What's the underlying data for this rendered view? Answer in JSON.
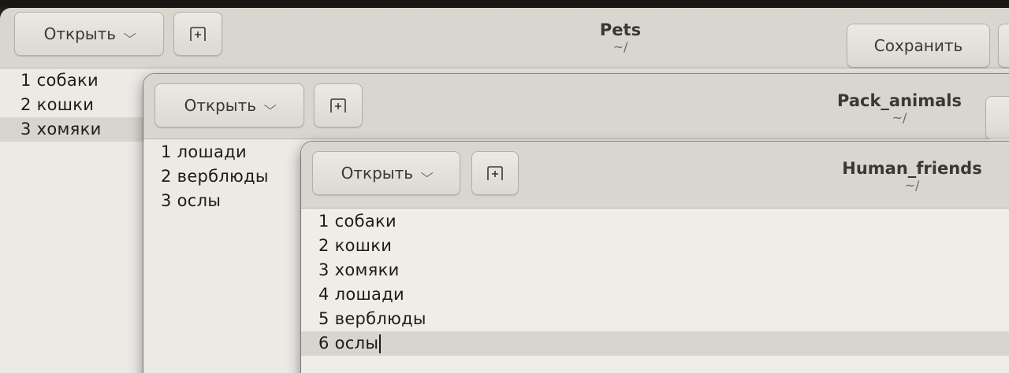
{
  "pets_window": {
    "open_label": "Открыть",
    "title": "Pets",
    "subtitle": "~/",
    "save_label": "Сохранить",
    "lines": [
      "1 собаки",
      "2 кошки",
      "3 хомяки"
    ]
  },
  "pack_window": {
    "open_label": "Открыть",
    "title": "Pack_animals",
    "subtitle": "~/",
    "lines": [
      "1 лошади",
      "2 верблюды",
      "3 ослы"
    ]
  },
  "human_window": {
    "open_label": "Открыть",
    "title": "Human_friends",
    "subtitle": "~/",
    "lines": [
      "1 собаки",
      "2 кошки",
      "3 хомяки",
      "4 лошади",
      "5 верблюды",
      "6 ослы"
    ]
  },
  "icons": {
    "open_dropdown": "chevron-down-icon",
    "new_document": "new-tab-icon"
  },
  "colors": {
    "header_bg": "#d9d6cf",
    "editor_bg": "#eceae5",
    "current_line": "#d8d5cf",
    "text": "#1d1c19"
  }
}
